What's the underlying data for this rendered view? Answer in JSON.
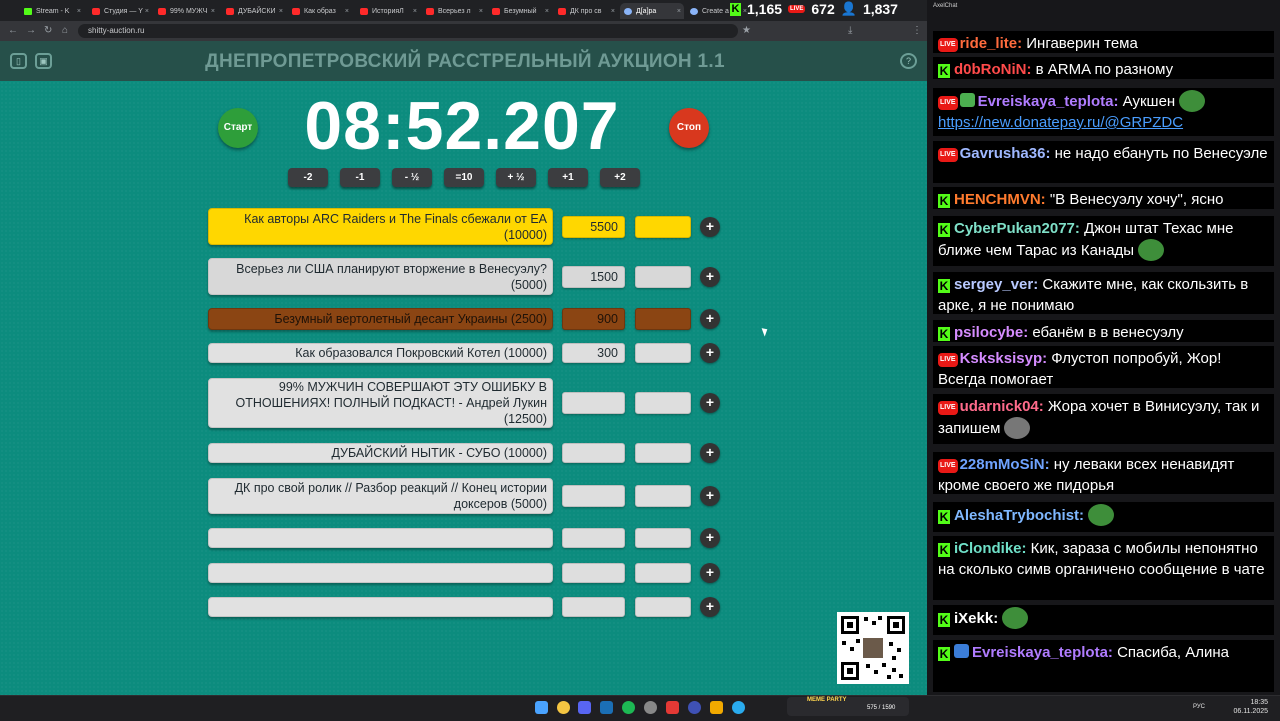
{
  "browser": {
    "tabs": [
      {
        "label": "Stream - K",
        "icon": "kick"
      },
      {
        "label": "Студия — Y",
        "icon": "youtube"
      },
      {
        "label": "99% МУЖЧ",
        "icon": "youtube"
      },
      {
        "label": "ДУБАЙСКИ",
        "icon": "youtube"
      },
      {
        "label": "Как образ",
        "icon": "youtube"
      },
      {
        "label": "ИсторияЛ",
        "icon": "youtube"
      },
      {
        "label": "Всерьез л",
        "icon": "youtube"
      },
      {
        "label": "Безумный",
        "icon": "youtube"
      },
      {
        "label": "ДК про св",
        "icon": "youtube"
      },
      {
        "label": "Д[a]ра",
        "icon": "globe"
      },
      {
        "label": "Create a Y",
        "icon": "globe"
      }
    ],
    "url": "shitty-auction.ru"
  },
  "stream_stats": {
    "kick_viewers": "1,165",
    "live_viewers": "672",
    "total_viewers": "1,837"
  },
  "auction": {
    "title": "ДНЕПРОПЕТРОВСКИЙ РАССТРЕЛЬНЫЙ АУКЦИОН 1.1",
    "timer": "08:52.207",
    "start_label": "Старт",
    "stop_label": "Стоп",
    "adjust_buttons": [
      "-2",
      "-1",
      "- ½",
      "=10",
      "+ ½",
      "+1",
      "+2"
    ],
    "lots": [
      {
        "name": "Как авторы ARC Raiders и The Finals сбежали от EA (10000)",
        "bid": "5500",
        "style": "yellow"
      },
      {
        "name": "Всерьез ли США планируют вторжение в Венесуэлу? (5000)",
        "bid": "1500",
        "style": "lightgrey"
      },
      {
        "name": "Безумный вертолетный десант Украины (2500)",
        "bid": "900",
        "style": "brown"
      },
      {
        "name": "Как образовался Покровский Котел (10000)",
        "bid": "300",
        "style": "normal"
      },
      {
        "name": "99% МУЖЧИН СОВЕРШАЮТ ЭТУ ОШИБКУ В ОТНОШЕНИЯХ! ПОЛНЫЙ ПОДКАСТ! - Андрей Лукин (12500)",
        "bid": "",
        "style": "normal"
      },
      {
        "name": "ДУБАЙСКИЙ НЫТИК - СУБО (10000)",
        "bid": "",
        "style": "normal"
      },
      {
        "name": "ДК про свой ролик // Разбор реакций // Конец истории доксеров (5000)",
        "bid": "",
        "style": "normal"
      },
      {
        "name": "",
        "bid": "",
        "style": "normal"
      },
      {
        "name": "",
        "bid": "",
        "style": "normal"
      },
      {
        "name": "",
        "bid": "",
        "style": "normal"
      }
    ],
    "plus_label": "+"
  },
  "chat": {
    "window_title": "AxelChat",
    "messages": [
      {
        "badges": [
          "live"
        ],
        "nick": "ride_lite",
        "color": "#ff6b3d",
        "text": "Ингаверин тема"
      },
      {
        "badges": [
          "kick"
        ],
        "nick": "d0bRoNiN",
        "color": "#ff4b4b",
        "text": "в ARMA по разному"
      },
      {
        "badges": [
          "live",
          "sub"
        ],
        "nick": "Evreiskaya_teplota",
        "color": "#b07cff",
        "text": "Аукшен",
        "link": "https://new.donatepay.ru/@GRPZDC"
      },
      {
        "badges": [
          "live"
        ],
        "nick": "Gavrusha36",
        "color": "#9fb8ff",
        "text": "не надо ебануть по Венесуэле"
      },
      {
        "badges": [
          "kick"
        ],
        "nick": "HENCHMVN",
        "color": "#ff7b2e",
        "text": "\"В Венесуэлу хочу\", ясно"
      },
      {
        "badges": [
          "kick"
        ],
        "nick": "CyberPukan2077",
        "color": "#7fe0c8",
        "text": "Джон штат Техас мне ближе чем Тарас из Канады"
      },
      {
        "badges": [
          "kick"
        ],
        "nick": "sergey_ver",
        "color": "#b8c9ff",
        "text": "Скажите мне, как скользить в арке, я не понимаю"
      },
      {
        "badges": [
          "kick"
        ],
        "nick": "psilocybe",
        "color": "#d58cff",
        "text": "ебанём в в венесуэлу"
      },
      {
        "badges": [
          "live"
        ],
        "nick": "Ksksksisyp",
        "color": "#d58cff",
        "text": "Флустоп попробуй, Жор! Всегда помогает"
      },
      {
        "badges": [
          "live"
        ],
        "nick": "udarnick04",
        "color": "#ff6b8b",
        "text": "Жора хочет в Винисуэлу, так и запишем"
      },
      {
        "badges": [
          "live"
        ],
        "nick": "228mMoSiN",
        "color": "#6fa3ff",
        "text": "ну леваки всех ненавидят кроме своего же пидорья"
      },
      {
        "badges": [
          "kick"
        ],
        "nick": "AleshaTrybochist",
        "color": "#7fb8ff",
        "text": ""
      },
      {
        "badges": [
          "kick"
        ],
        "nick": "iClondike",
        "color": "#6fe0c8",
        "text": "Кик, зараза с мобилы непонятно на сколько симв органичено сообщение в чате"
      },
      {
        "badges": [
          "kick"
        ],
        "nick": "iXekk",
        "color": "#ffffff",
        "text": ""
      },
      {
        "badges": [
          "kick",
          "sword"
        ],
        "nick": "Evreiskaya_teplota",
        "color": "#b07cff",
        "text": "Спасиба, Алина"
      }
    ]
  },
  "taskbar": {
    "lang": "РУС",
    "time": "18:35",
    "date": "06.11.2025",
    "meme_label": "MEME PARTY",
    "meme_counter": "575 / 1590"
  }
}
